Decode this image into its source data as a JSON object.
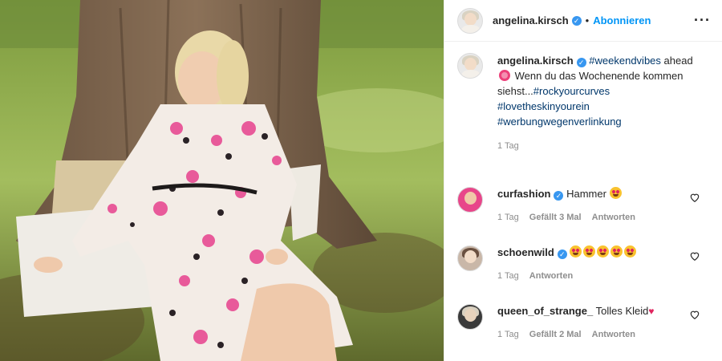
{
  "post": {
    "username": "angelina.kirsch",
    "follow_label": "Abonnieren",
    "more_icon": "more-horizontal-icon",
    "caption": {
      "username": "angelina.kirsch",
      "hashtag_1": "#weekendvibes",
      "text_1": "ahead",
      "text_2": "Wenn du das Wochenende kommen siehst...",
      "hashtag_2": "#rockyourcurves",
      "hashtag_3": "#lovetheskinyourein",
      "hashtag_4": "#werbungwegenverlinkung",
      "time": "1 Tag"
    }
  },
  "comments": [
    {
      "username": "curfashion",
      "verified": true,
      "text": "Hammer",
      "time": "1 Tag",
      "likes": "Gefällt 3 Mal",
      "reply": "Antworten",
      "avatar_color": "#e8468a"
    },
    {
      "username": "schoenwild",
      "verified": true,
      "text": "",
      "emoji_count": 5,
      "time": "1 Tag",
      "likes": "",
      "reply": "Antworten",
      "avatar_color": "#c9b7a8"
    },
    {
      "username": "queen_of_strange_",
      "verified": false,
      "text": "Tolles Kleid",
      "time": "1 Tag",
      "likes": "Gefällt 2 Mal",
      "reply": "Antworten",
      "avatar_color": "#6b6b6b"
    }
  ],
  "colors": {
    "link": "#0095f6",
    "hashtag": "#00376b",
    "muted": "#8e8e8e",
    "verified": "#3897f0"
  }
}
